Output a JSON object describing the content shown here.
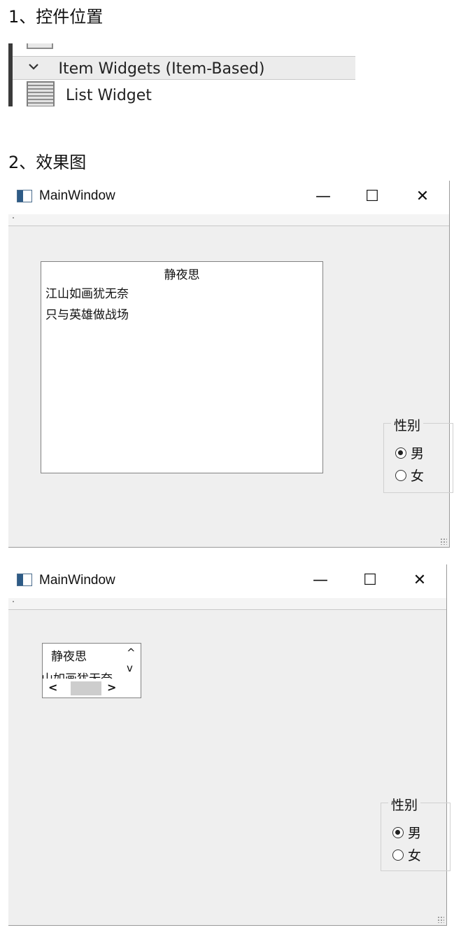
{
  "section1": {
    "heading": "1、控件位置"
  },
  "widget_box": {
    "category_chevron": "chevron-down",
    "category_label": "Item Widgets (Item-Based)",
    "item_label": "List Widget"
  },
  "section2": {
    "heading": "2、效果图"
  },
  "window1": {
    "title": "MainWindow",
    "minimize": "—",
    "maximize": "☐",
    "close": "✕",
    "list": {
      "header": "静夜思",
      "items": [
        "江山如画犹无奈",
        "只与英雄做战场"
      ]
    },
    "group": {
      "title": "性别",
      "options": [
        {
          "label": "男",
          "checked": true
        },
        {
          "label": "女",
          "checked": false
        }
      ]
    }
  },
  "window2": {
    "title": "MainWindow",
    "minimize": "—",
    "maximize": "☐",
    "close": "✕",
    "list": {
      "header": "静夜思",
      "partial_item": "山如画犹无奈",
      "scroll_up": "^",
      "scroll_down": "v",
      "scroll_left": "<",
      "scroll_right": ">"
    },
    "group": {
      "title": "性别",
      "options": [
        {
          "label": "男",
          "checked": true
        },
        {
          "label": "女",
          "checked": false
        }
      ]
    }
  }
}
